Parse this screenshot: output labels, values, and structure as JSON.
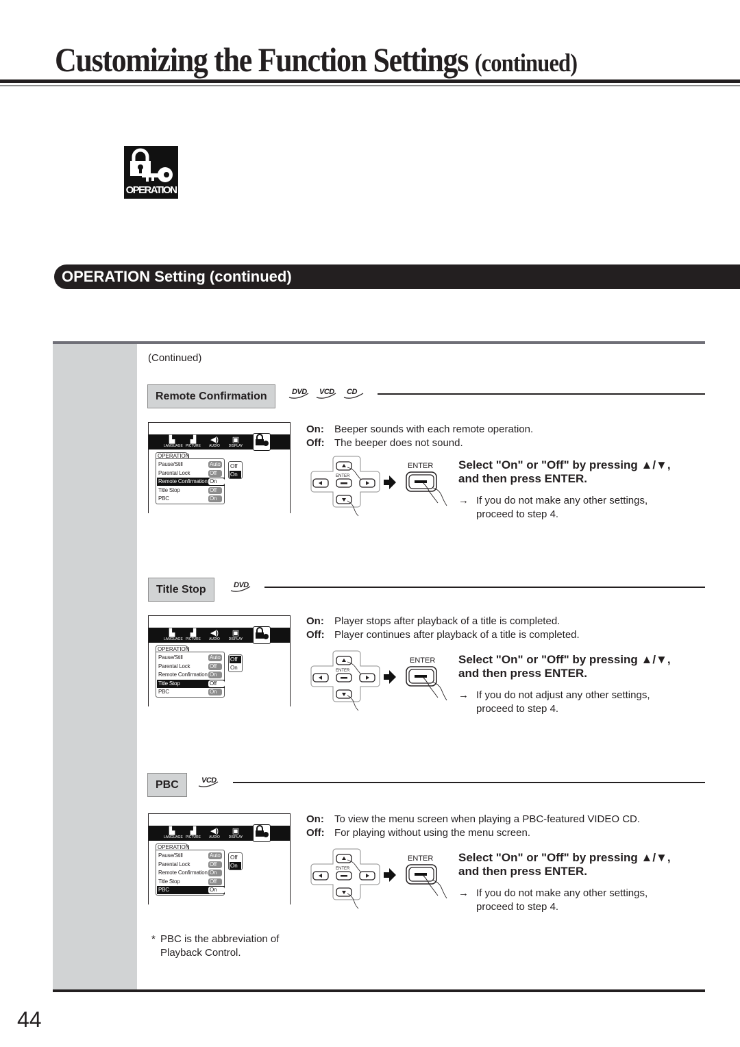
{
  "header": {
    "title": "Customizing the Function Settings",
    "title_suffix": "(continued)"
  },
  "category_icon": {
    "icon": "lock-key-icon",
    "label": "OPERATION"
  },
  "section": {
    "title": "OPERATION Setting (continued)"
  },
  "continued_label": "(Continued)",
  "osd_common": {
    "tabs": [
      "LANGUAGE",
      "PICTURE",
      "AUDIO",
      "DISPLAY"
    ],
    "panel_title": "OPERATION",
    "rows": [
      "Pause/Still",
      "Parental Lock",
      "Remote Confirmation",
      "Title Stop",
      "PBC"
    ],
    "options": [
      "Off",
      "On"
    ]
  },
  "settings": [
    {
      "label": "Remote Confirmation",
      "discs": [
        "DVD",
        "VCD",
        "CD"
      ],
      "osd": {
        "values": [
          "Auto",
          "Off",
          "On",
          "Off",
          "On"
        ],
        "selected_row": 2,
        "selected_option": 1
      },
      "on_key": "On:",
      "on_text": "Beeper sounds with each remote operation.",
      "off_key": "Off:",
      "off_text": "The beeper does not sound.",
      "enter_label": "ENTER",
      "instruction_line1": "Select \"On\" or \"Off\" by pressing ▲/▼,",
      "instruction_line2": "and then press ENTER.",
      "note_arrow": "→",
      "note_line1": "If you do not make any other settings,",
      "note_line2": "proceed to step 4."
    },
    {
      "label": "Title Stop",
      "discs": [
        "DVD"
      ],
      "osd": {
        "values": [
          "Auto",
          "Off",
          "On",
          "Off",
          "On"
        ],
        "selected_row": 3,
        "selected_option": 0
      },
      "on_key": "On:",
      "on_text": "Player stops after playback of a title is completed.",
      "off_key": "Off:",
      "off_text": "Player continues after playback of a title is completed.",
      "enter_label": "ENTER",
      "instruction_line1": "Select \"On\" or \"Off\" by pressing ▲/▼,",
      "instruction_line2": "and then press ENTER.",
      "note_arrow": "→",
      "note_line1": "If you do not adjust any other settings,",
      "note_line2": "proceed to step 4."
    },
    {
      "label": "PBC",
      "discs": [
        "VCD"
      ],
      "osd": {
        "values": [
          "Auto",
          "Off",
          "On",
          "Off",
          "On"
        ],
        "selected_row": 4,
        "selected_option": 1
      },
      "on_key": "On:",
      "on_text": "To view the menu screen when playing a PBC-featured VIDEO CD.",
      "off_key": "Off:",
      "off_text": "For playing without using the menu screen.",
      "enter_label": "ENTER",
      "instruction_line1": "Select \"On\" or \"Off\" by pressing ▲/▼,",
      "instruction_line2": "and then press ENTER.",
      "note_arrow": "→",
      "note_line1": "If you do not make any other settings,",
      "note_line2": "proceed to step 4."
    }
  ],
  "footnote": {
    "marker": "*",
    "line1": "PBC is the abbreviation of",
    "line2": "Playback Control."
  },
  "page_number": "44"
}
